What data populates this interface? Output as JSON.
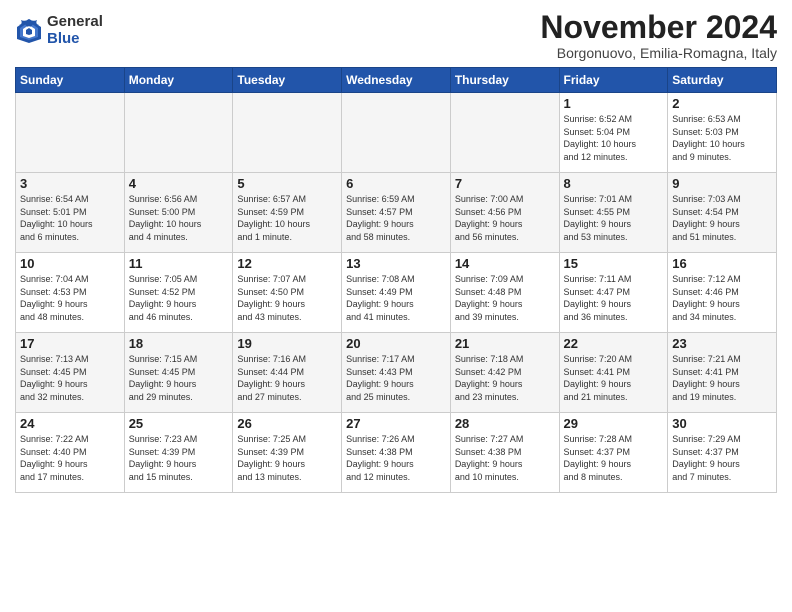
{
  "logo": {
    "general": "General",
    "blue": "Blue"
  },
  "header": {
    "month": "November 2024",
    "location": "Borgonuovo, Emilia-Romagna, Italy"
  },
  "weekdays": [
    "Sunday",
    "Monday",
    "Tuesday",
    "Wednesday",
    "Thursday",
    "Friday",
    "Saturday"
  ],
  "weeks": [
    [
      {
        "day": "",
        "info": "",
        "empty": true
      },
      {
        "day": "",
        "info": "",
        "empty": true
      },
      {
        "day": "",
        "info": "",
        "empty": true
      },
      {
        "day": "",
        "info": "",
        "empty": true
      },
      {
        "day": "",
        "info": "",
        "empty": true
      },
      {
        "day": "1",
        "info": "Sunrise: 6:52 AM\nSunset: 5:04 PM\nDaylight: 10 hours\nand 12 minutes."
      },
      {
        "day": "2",
        "info": "Sunrise: 6:53 AM\nSunset: 5:03 PM\nDaylight: 10 hours\nand 9 minutes."
      }
    ],
    [
      {
        "day": "3",
        "info": "Sunrise: 6:54 AM\nSunset: 5:01 PM\nDaylight: 10 hours\nand 6 minutes."
      },
      {
        "day": "4",
        "info": "Sunrise: 6:56 AM\nSunset: 5:00 PM\nDaylight: 10 hours\nand 4 minutes."
      },
      {
        "day": "5",
        "info": "Sunrise: 6:57 AM\nSunset: 4:59 PM\nDaylight: 10 hours\nand 1 minute."
      },
      {
        "day": "6",
        "info": "Sunrise: 6:59 AM\nSunset: 4:57 PM\nDaylight: 9 hours\nand 58 minutes."
      },
      {
        "day": "7",
        "info": "Sunrise: 7:00 AM\nSunset: 4:56 PM\nDaylight: 9 hours\nand 56 minutes."
      },
      {
        "day": "8",
        "info": "Sunrise: 7:01 AM\nSunset: 4:55 PM\nDaylight: 9 hours\nand 53 minutes."
      },
      {
        "day": "9",
        "info": "Sunrise: 7:03 AM\nSunset: 4:54 PM\nDaylight: 9 hours\nand 51 minutes."
      }
    ],
    [
      {
        "day": "10",
        "info": "Sunrise: 7:04 AM\nSunset: 4:53 PM\nDaylight: 9 hours\nand 48 minutes."
      },
      {
        "day": "11",
        "info": "Sunrise: 7:05 AM\nSunset: 4:52 PM\nDaylight: 9 hours\nand 46 minutes."
      },
      {
        "day": "12",
        "info": "Sunrise: 7:07 AM\nSunset: 4:50 PM\nDaylight: 9 hours\nand 43 minutes."
      },
      {
        "day": "13",
        "info": "Sunrise: 7:08 AM\nSunset: 4:49 PM\nDaylight: 9 hours\nand 41 minutes."
      },
      {
        "day": "14",
        "info": "Sunrise: 7:09 AM\nSunset: 4:48 PM\nDaylight: 9 hours\nand 39 minutes."
      },
      {
        "day": "15",
        "info": "Sunrise: 7:11 AM\nSunset: 4:47 PM\nDaylight: 9 hours\nand 36 minutes."
      },
      {
        "day": "16",
        "info": "Sunrise: 7:12 AM\nSunset: 4:46 PM\nDaylight: 9 hours\nand 34 minutes."
      }
    ],
    [
      {
        "day": "17",
        "info": "Sunrise: 7:13 AM\nSunset: 4:45 PM\nDaylight: 9 hours\nand 32 minutes."
      },
      {
        "day": "18",
        "info": "Sunrise: 7:15 AM\nSunset: 4:45 PM\nDaylight: 9 hours\nand 29 minutes."
      },
      {
        "day": "19",
        "info": "Sunrise: 7:16 AM\nSunset: 4:44 PM\nDaylight: 9 hours\nand 27 minutes."
      },
      {
        "day": "20",
        "info": "Sunrise: 7:17 AM\nSunset: 4:43 PM\nDaylight: 9 hours\nand 25 minutes."
      },
      {
        "day": "21",
        "info": "Sunrise: 7:18 AM\nSunset: 4:42 PM\nDaylight: 9 hours\nand 23 minutes."
      },
      {
        "day": "22",
        "info": "Sunrise: 7:20 AM\nSunset: 4:41 PM\nDaylight: 9 hours\nand 21 minutes."
      },
      {
        "day": "23",
        "info": "Sunrise: 7:21 AM\nSunset: 4:41 PM\nDaylight: 9 hours\nand 19 minutes."
      }
    ],
    [
      {
        "day": "24",
        "info": "Sunrise: 7:22 AM\nSunset: 4:40 PM\nDaylight: 9 hours\nand 17 minutes."
      },
      {
        "day": "25",
        "info": "Sunrise: 7:23 AM\nSunset: 4:39 PM\nDaylight: 9 hours\nand 15 minutes."
      },
      {
        "day": "26",
        "info": "Sunrise: 7:25 AM\nSunset: 4:39 PM\nDaylight: 9 hours\nand 13 minutes."
      },
      {
        "day": "27",
        "info": "Sunrise: 7:26 AM\nSunset: 4:38 PM\nDaylight: 9 hours\nand 12 minutes."
      },
      {
        "day": "28",
        "info": "Sunrise: 7:27 AM\nSunset: 4:38 PM\nDaylight: 9 hours\nand 10 minutes."
      },
      {
        "day": "29",
        "info": "Sunrise: 7:28 AM\nSunset: 4:37 PM\nDaylight: 9 hours\nand 8 minutes."
      },
      {
        "day": "30",
        "info": "Sunrise: 7:29 AM\nSunset: 4:37 PM\nDaylight: 9 hours\nand 7 minutes."
      }
    ]
  ]
}
